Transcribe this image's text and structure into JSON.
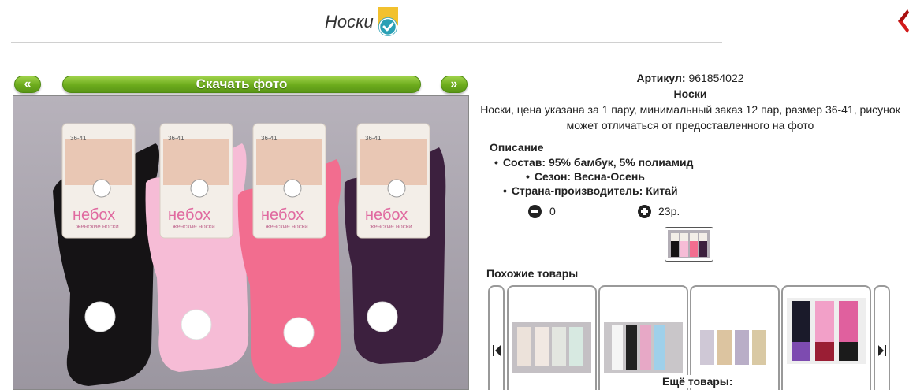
{
  "header": {
    "title": "Носки",
    "verified_icon": "check-badge-icon",
    "close_icon": "close-arrow-icon"
  },
  "gallery": {
    "prev_label": "«",
    "download_label": "Скачать фото",
    "next_label": "»",
    "photo_brand": "небох",
    "photo_sub": "женские носки",
    "photo_sizes": "36-41"
  },
  "product": {
    "article_label": "Артикул:",
    "article_value": "961854022",
    "name": "Носки",
    "description": "Носки, цена указана за 1 пару, минимальный заказ 12 пар, размер 36-41, рисунок может отличаться от предоставленного на фото",
    "desc_heading": "Описание",
    "attributes": [
      "Состав: 95% бамбук, 5% полиамид",
      "Сезон: Весна-Осень",
      "Страна-производитель: Китай"
    ],
    "quantity": "0",
    "price": "23р."
  },
  "similar": {
    "heading": "Похожие товары",
    "more_label": "Ещё товары:",
    "left_arrow": "prev-arrow-icon",
    "right_arrow": "next-arrow-icon"
  },
  "colors": {
    "accent_green": "#6cab1c",
    "sock_colors": [
      "#141214",
      "#f4b6d2",
      "#f26b8e",
      "#3a1f3c"
    ]
  }
}
